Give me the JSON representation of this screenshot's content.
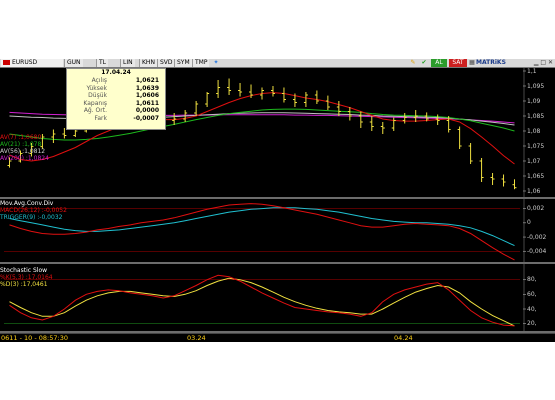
{
  "toolbar": {
    "symbol": "EURUSD",
    "buttons": [
      "GUN",
      "TL",
      "LIN",
      "KHN",
      "SVD",
      "SYM",
      "TMP"
    ],
    "buy_label": "AL",
    "sell_label": "SAT",
    "matrix_label": "MATRiKS"
  },
  "info_box": {
    "date": "17.04.24",
    "rows": [
      {
        "label": "Açılış",
        "value": "1,0621"
      },
      {
        "label": "Yüksek",
        "value": "1,0639"
      },
      {
        "label": "Düşük",
        "value": "1,0606"
      },
      {
        "label": "Kapanış",
        "value": "1,0611"
      },
      {
        "label": "Ağ. Ort.",
        "value": "0,0000"
      },
      {
        "label": "Fark",
        "value": "-0,0007"
      }
    ]
  },
  "price_legend": {
    "ma7": ":1,0680",
    "ma21": ":1,078",
    "ma56": ":1,0812",
    "ma200": ":1,0824",
    "ma7_label": "AV(7)",
    "ma21_label": "AV(21)",
    "ma56_label": "AV(56)",
    "ma200_label": "AV(200)"
  },
  "macd_legend": {
    "title": "Mov.Avg.Conv.Div",
    "macd": "MACD(26,12) :-0,0052",
    "trigger": "TRIGGER(9) :-0,0032"
  },
  "stoch_legend": {
    "title": "Stochastic Slow",
    "k": "%K(5,3)  :17,0164",
    "d": "%D(3)    :17,0461"
  },
  "price_axis": [
    "1,1",
    "1,095",
    "1,09",
    "1,085",
    "1,08",
    "1,075",
    "1,07",
    "1,065",
    "1,06"
  ],
  "macd_axis": [
    "0,002",
    "0",
    "-0,002",
    "-0,004"
  ],
  "stoch_axis": [
    "80,",
    "60,",
    "40,",
    "20,"
  ],
  "status": {
    "clock": "0611 - 10 - 08:57:30",
    "date1": "03.24",
    "date2": "04.24"
  },
  "colors": {
    "background": "#000000",
    "ma7": "#e01010",
    "ma21": "#1db81d",
    "ma56": "#c0c0c0",
    "ma200": "#d020d0",
    "bars": "#f0e040",
    "macd": "#e01010",
    "trigger": "#20c0d0",
    "stoch_k": "#e01010",
    "stoch_d": "#f0e040"
  },
  "chart_data": [
    {
      "type": "ohlc",
      "title": "EURUSD",
      "ylim": [
        1.058,
        1.101
      ],
      "bars": [
        [
          1.0685,
          1.0712,
          1.0678,
          1.07
        ],
        [
          1.07,
          1.0735,
          1.0695,
          1.0725
        ],
        [
          1.0725,
          1.076,
          1.0715,
          1.0748
        ],
        [
          1.0748,
          1.079,
          1.074,
          1.078
        ],
        [
          1.078,
          1.0805,
          1.076,
          1.079
        ],
        [
          1.079,
          1.081,
          1.0775,
          1.0785
        ],
        [
          1.0785,
          1.0815,
          1.078,
          1.08
        ],
        [
          1.08,
          1.084,
          1.0795,
          1.083
        ],
        [
          1.083,
          1.085,
          1.0815,
          1.0825
        ],
        [
          1.0825,
          1.085,
          1.082,
          1.084
        ],
        [
          1.084,
          1.0865,
          1.0825,
          1.085
        ],
        [
          1.085,
          1.0875,
          1.0835,
          1.0845
        ],
        [
          1.0845,
          1.088,
          1.083,
          1.0838
        ],
        [
          1.0838,
          1.0855,
          1.082,
          1.0828
        ],
        [
          1.0828,
          1.0848,
          1.0812,
          1.0835
        ],
        [
          1.0835,
          1.086,
          1.082,
          1.084
        ],
        [
          1.084,
          1.087,
          1.083,
          1.086
        ],
        [
          1.086,
          1.09,
          1.085,
          1.089
        ],
        [
          1.089,
          1.093,
          1.088,
          1.0925
        ],
        [
          1.0925,
          1.097,
          1.091,
          1.0945
        ],
        [
          1.0945,
          1.0975,
          1.092,
          1.0935
        ],
        [
          1.0935,
          1.096,
          1.0915,
          1.093
        ],
        [
          1.093,
          1.0955,
          1.091,
          1.092
        ],
        [
          1.092,
          1.0945,
          1.0905,
          1.0935
        ],
        [
          1.0935,
          1.095,
          1.0915,
          1.0925
        ],
        [
          1.0925,
          1.0945,
          1.0895,
          1.0905
        ],
        [
          1.0905,
          1.0925,
          1.088,
          1.0895
        ],
        [
          1.0895,
          1.093,
          1.088,
          1.092
        ],
        [
          1.092,
          1.0935,
          1.089,
          1.09
        ],
        [
          1.09,
          1.0918,
          1.087,
          1.088
        ],
        [
          1.088,
          1.09,
          1.085,
          1.0865
        ],
        [
          1.0865,
          1.088,
          1.0835,
          1.085
        ],
        [
          1.085,
          1.0865,
          1.081,
          1.083
        ],
        [
          1.083,
          1.085,
          1.08,
          1.0815
        ],
        [
          1.0815,
          1.083,
          1.079,
          1.081
        ],
        [
          1.081,
          1.0845,
          1.08,
          1.0835
        ],
        [
          1.0835,
          1.086,
          1.0825,
          1.0845
        ],
        [
          1.0845,
          1.087,
          1.083,
          1.085
        ],
        [
          1.085,
          1.0862,
          1.0832,
          1.084
        ],
        [
          1.084,
          1.0855,
          1.082,
          1.0835
        ],
        [
          1.0835,
          1.085,
          1.0795,
          1.0805
        ],
        [
          1.0805,
          1.0815,
          1.074,
          1.075
        ],
        [
          1.075,
          1.076,
          1.069,
          1.07
        ],
        [
          1.07,
          1.071,
          1.063,
          1.0645
        ],
        [
          1.0645,
          1.066,
          1.062,
          1.064
        ],
        [
          1.064,
          1.0655,
          1.0615,
          1.063
        ],
        [
          1.0621,
          1.0639,
          1.0606,
          1.0611
        ]
      ],
      "ma7": [
        1.072,
        1.0705,
        1.07,
        1.0705,
        1.0715,
        1.073,
        1.0745,
        1.0765,
        1.0785,
        1.08,
        1.0815,
        1.0825,
        1.0832,
        1.0838,
        1.0838,
        1.0838,
        1.0842,
        1.085,
        1.0865,
        1.088,
        1.0895,
        1.0908,
        1.0918,
        1.0925,
        1.0928,
        1.0925,
        1.0918,
        1.091,
        1.0905,
        1.0898,
        1.0888,
        1.0878,
        1.0865,
        1.0852,
        1.084,
        1.0835,
        1.0833,
        1.0833,
        1.0835,
        1.0838,
        1.084,
        1.083,
        1.0808,
        1.078,
        1.075,
        1.0718,
        1.069
      ],
      "ma21": [
        1.079,
        1.0785,
        1.078,
        1.0775,
        1.0772,
        1.077,
        1.077,
        1.0772,
        1.0775,
        1.078,
        1.0786,
        1.0792,
        1.08,
        1.0808,
        1.0815,
        1.0822,
        1.083,
        1.0838,
        1.0845,
        1.0852,
        1.0858,
        1.0862,
        1.0866,
        1.087,
        1.0872,
        1.0873,
        1.0873,
        1.0872,
        1.087,
        1.0868,
        1.0866,
        1.0864,
        1.0862,
        1.0858,
        1.0855,
        1.0853,
        1.0852,
        1.0851,
        1.085,
        1.0848,
        1.0845,
        1.084,
        1.0834,
        1.0826,
        1.0818,
        1.081,
        1.08
      ],
      "ma56": [
        1.085,
        1.0848,
        1.0846,
        1.0845,
        1.0843,
        1.0842,
        1.0841,
        1.084,
        1.084,
        1.084,
        1.0841,
        1.0842,
        1.0843,
        1.0844,
        1.0846,
        1.0848,
        1.085,
        1.0852,
        1.0854,
        1.0856,
        1.0858,
        1.0859,
        1.086,
        1.0861,
        1.0861,
        1.0861,
        1.086,
        1.0859,
        1.0858,
        1.0857,
        1.0856,
        1.0855,
        1.0853,
        1.0852,
        1.085,
        1.0849,
        1.0848,
        1.0847,
        1.0846,
        1.0845,
        1.0843,
        1.084,
        1.0837,
        1.0833,
        1.0829,
        1.0825,
        1.082
      ],
      "ma200": [
        1.0862,
        1.086,
        1.0858,
        1.0856,
        1.0855,
        1.0854,
        1.0853,
        1.0852,
        1.0851,
        1.0851,
        1.0851,
        1.0851,
        1.0851,
        1.0852,
        1.0852,
        1.0852,
        1.0853,
        1.0853,
        1.0853,
        1.0854,
        1.0854,
        1.0854,
        1.0854,
        1.0854,
        1.0854,
        1.0854,
        1.0853,
        1.0853,
        1.0852,
        1.0852,
        1.0851,
        1.085,
        1.0849,
        1.0848,
        1.0847,
        1.0846,
        1.0845,
        1.0844,
        1.0843,
        1.0842,
        1.0841,
        1.0839,
        1.0837,
        1.0835,
        1.0833,
        1.083,
        1.0827
      ]
    },
    {
      "type": "line",
      "title": "Mov.Avg.Conv.Div",
      "ylim": [
        -0.0055,
        0.0032
      ],
      "series": [
        {
          "name": "MACD(26,12)",
          "values": [
            -0.0003,
            -0.0008,
            -0.0012,
            -0.0015,
            -0.0016,
            -0.0016,
            -0.0015,
            -0.0013,
            -0.001,
            -0.0008,
            -0.0005,
            -0.0003,
            0.0,
            0.0002,
            0.0004,
            0.0007,
            0.0011,
            0.0015,
            0.0019,
            0.0022,
            0.0025,
            0.0026,
            0.0027,
            0.0026,
            0.0024,
            0.0021,
            0.0018,
            0.0015,
            0.0012,
            0.0008,
            0.0004,
            0.0,
            -0.0004,
            -0.0006,
            -0.0006,
            -0.0004,
            -0.0002,
            -0.0001,
            -0.0002,
            -0.0003,
            -0.0004,
            -0.0008,
            -0.0015,
            -0.0025,
            -0.0035,
            -0.0044,
            -0.0052
          ]
        },
        {
          "name": "TRIGGER(9)",
          "values": [
            0.0006,
            0.0003,
            0.0,
            -0.0003,
            -0.0006,
            -0.0009,
            -0.0011,
            -0.0012,
            -0.0012,
            -0.0011,
            -0.001,
            -0.0008,
            -0.0006,
            -0.0004,
            -0.0002,
            0.0,
            0.0003,
            0.0006,
            0.0009,
            0.0012,
            0.0015,
            0.0017,
            0.0019,
            0.002,
            0.0021,
            0.0021,
            0.0021,
            0.002,
            0.0019,
            0.0017,
            0.0015,
            0.0012,
            0.0009,
            0.0006,
            0.0004,
            0.0002,
            0.0001,
            0.0,
            0.0,
            -0.0001,
            -0.0002,
            -0.0004,
            -0.0007,
            -0.0012,
            -0.0018,
            -0.0025,
            -0.0032
          ]
        }
      ]
    },
    {
      "type": "line",
      "title": "Stochastic Slow",
      "ylim": [
        10,
        100
      ],
      "series": [
        {
          "name": "%K(5,3)",
          "values": [
            45,
            35,
            28,
            25,
            30,
            40,
            52,
            60,
            64,
            66,
            65,
            62,
            60,
            58,
            55,
            58,
            65,
            72,
            80,
            86,
            84,
            78,
            70,
            62,
            55,
            48,
            42,
            40,
            38,
            36,
            35,
            33,
            30,
            35,
            50,
            60,
            66,
            70,
            74,
            76,
            66,
            52,
            38,
            28,
            22,
            18,
            17
          ]
        },
        {
          "name": "%D(3)",
          "values": [
            50,
            42,
            35,
            30,
            30,
            35,
            44,
            52,
            58,
            62,
            64,
            64,
            62,
            60,
            58,
            57,
            60,
            65,
            72,
            78,
            82,
            80,
            76,
            70,
            63,
            56,
            50,
            45,
            41,
            38,
            36,
            35,
            33,
            33,
            40,
            48,
            56,
            63,
            68,
            72,
            70,
            62,
            50,
            40,
            31,
            24,
            17
          ]
        }
      ]
    }
  ]
}
